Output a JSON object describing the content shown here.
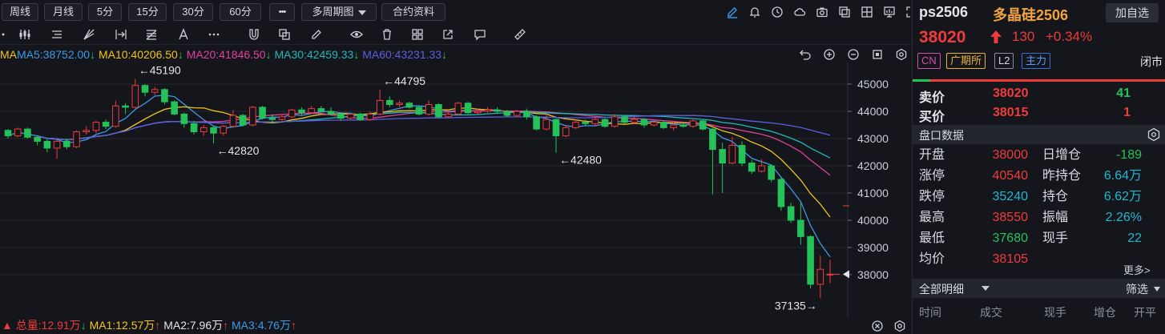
{
  "periods": {
    "buttons": [
      "周线",
      "月线",
      "5分",
      "15分",
      "30分",
      "60分"
    ],
    "more_label": "•••",
    "multi_label": "多周期图",
    "contract_label": "合约资料"
  },
  "ma_legend": {
    "title": "MA",
    "ma5": "MA5:38752.00",
    "ma10": "MA10:40206.50",
    "ma20": "MA20:41846.50",
    "ma30": "MA30:42459.33",
    "ma60": "MA60:43231.33",
    "colors": {
      "ma5": "#3a9be6",
      "ma10": "#f0c419",
      "ma20": "#e040a0",
      "ma30": "#20b8b8",
      "ma60": "#5a5ee0",
      "title": "#f0c419"
    }
  },
  "volume_legend": {
    "total": "总量:12.91万",
    "ma1": "MA1:12.57万",
    "ma2": "MA2:7.96万",
    "ma3": "MA3:4.76万",
    "colors": {
      "total": "#ee3b3b",
      "ma1": "#f0c419",
      "ma2": "#e2e4e9",
      "ma3": "#3a9be6"
    }
  },
  "chart_data": {
    "type": "candlestick",
    "y_ticks": [
      45000,
      44000,
      43000,
      42000,
      41000,
      40000,
      39000,
      38000
    ],
    "ylim": [
      37000,
      45600
    ],
    "annotations": [
      {
        "text": "←45190",
        "value": 45190
      },
      {
        "text": "←44795",
        "value": 44795
      },
      {
        "text": "←42820",
        "value": 42820
      },
      {
        "text": "←42480",
        "value": 42480
      },
      {
        "text": "37135→",
        "value": 37135
      }
    ],
    "last_price": 38020,
    "candles": [
      [
        43300,
        43100,
        43350,
        43000
      ],
      [
        43100,
        43350,
        43400,
        43050
      ],
      [
        43350,
        43050,
        43400,
        43000
      ],
      [
        43050,
        42900,
        43100,
        42750
      ],
      [
        42900,
        42650,
        43000,
        42500
      ],
      [
        42650,
        42900,
        42950,
        42250
      ],
      [
        42900,
        42700,
        43000,
        42600
      ],
      [
        42700,
        43250,
        43300,
        42650
      ],
      [
        43250,
        43300,
        43450,
        43150
      ],
      [
        43300,
        43600,
        43650,
        43200
      ],
      [
        43600,
        43450,
        43700,
        43350
      ],
      [
        43450,
        44200,
        44400,
        43400
      ],
      [
        44200,
        44150,
        44300,
        43900
      ],
      [
        44150,
        44950,
        45190,
        44100
      ],
      [
        44950,
        44700,
        45000,
        44550
      ],
      [
        44700,
        44800,
        44900,
        44600
      ],
      [
        44800,
        44350,
        44850,
        44250
      ],
      [
        44350,
        43900,
        44400,
        43850
      ],
      [
        43900,
        43550,
        43950,
        43400
      ],
      [
        43550,
        43250,
        43650,
        43150
      ],
      [
        43250,
        43400,
        43500,
        43100
      ],
      [
        43400,
        43200,
        43450,
        42820
      ],
      [
        43200,
        43450,
        43500,
        43100
      ],
      [
        43450,
        43850,
        44050,
        43400
      ],
      [
        43850,
        43500,
        43900,
        43450
      ],
      [
        43500,
        44150,
        44200,
        43450
      ],
      [
        44150,
        43750,
        44200,
        43700
      ],
      [
        43750,
        43700,
        43900,
        43600
      ],
      [
        43700,
        43800,
        43900,
        43650
      ],
      [
        43800,
        44050,
        44100,
        43750
      ],
      [
        44050,
        43950,
        44150,
        43850
      ],
      [
        43950,
        44100,
        44200,
        43900
      ],
      [
        44100,
        44000,
        44200,
        43950
      ],
      [
        44000,
        43900,
        44150,
        43850
      ],
      [
        43900,
        43750,
        43950,
        43650
      ],
      [
        43750,
        43900,
        43950,
        43700
      ],
      [
        43900,
        43700,
        43950,
        43650
      ],
      [
        43700,
        43900,
        44000,
        43650
      ],
      [
        43900,
        44400,
        44795,
        43850
      ],
      [
        44400,
        44250,
        44550,
        44150
      ],
      [
        44250,
        44300,
        44400,
        44150
      ],
      [
        44300,
        44150,
        44350,
        44100
      ],
      [
        44150,
        43900,
        44200,
        43850
      ],
      [
        43900,
        44250,
        44400,
        43850
      ],
      [
        44250,
        43800,
        44300,
        43750
      ],
      [
        43800,
        43900,
        44050,
        43750
      ],
      [
        43900,
        44300,
        44350,
        43850
      ],
      [
        44300,
        43950,
        44350,
        43900
      ],
      [
        43950,
        44000,
        44100,
        43900
      ],
      [
        44000,
        44050,
        44150,
        43950
      ],
      [
        44050,
        44000,
        44150,
        43900
      ],
      [
        44000,
        43850,
        44050,
        43800
      ],
      [
        43850,
        44000,
        44050,
        43800
      ],
      [
        44000,
        43800,
        44100,
        43700
      ],
      [
        43800,
        43350,
        43850,
        43300
      ],
      [
        43350,
        43700,
        43850,
        43300
      ],
      [
        43700,
        43100,
        43750,
        42480
      ],
      [
        43100,
        43400,
        43500,
        43050
      ],
      [
        43400,
        43600,
        43700,
        43350
      ],
      [
        43600,
        43550,
        43700,
        43450
      ],
      [
        43550,
        43700,
        43800,
        43450
      ],
      [
        43700,
        43450,
        43750,
        43400
      ],
      [
        43450,
        43800,
        43900,
        43400
      ],
      [
        43800,
        43600,
        43850,
        43550
      ],
      [
        43600,
        43700,
        43800,
        43550
      ],
      [
        43700,
        43500,
        43750,
        43400
      ],
      [
        43500,
        43600,
        43700,
        43450
      ],
      [
        43600,
        43400,
        43650,
        43350
      ],
      [
        43400,
        43500,
        43600,
        43300
      ],
      [
        43500,
        43450,
        43600,
        43400
      ],
      [
        43450,
        43650,
        43700,
        43400
      ],
      [
        43650,
        43350,
        43700,
        43300
      ],
      [
        43350,
        42600,
        43400,
        40950
      ],
      [
        42600,
        42100,
        42850,
        41000
      ],
      [
        42100,
        42750,
        43050,
        42050
      ],
      [
        42750,
        42100,
        42900,
        42000
      ],
      [
        42100,
        41800,
        42200,
        41700
      ],
      [
        41800,
        42000,
        42250,
        41750
      ],
      [
        42000,
        41500,
        42050,
        41400
      ],
      [
        41500,
        40500,
        41550,
        40350
      ],
      [
        40500,
        40000,
        40650,
        39900
      ],
      [
        40000,
        39400,
        40650,
        39100
      ],
      [
        39400,
        37650,
        39450,
        37500
      ],
      [
        37650,
        38200,
        38700,
        37135
      ],
      [
        38000,
        38020,
        38550,
        37680
      ]
    ]
  },
  "price_axis_labels": [
    "45000",
    "44000",
    "43000",
    "42000",
    "41000",
    "40000",
    "39000",
    "38000"
  ],
  "right_panel": {
    "symbol": "ps2506",
    "name": "多晶硅2506",
    "add_label": "加自选",
    "last": "38020",
    "change": "130",
    "change_pct": "+0.34%",
    "tags": {
      "cn": "CN",
      "exchange": "广期所",
      "level": "L2",
      "main": "主力"
    },
    "status": "闭市",
    "ask": {
      "label": "卖价",
      "price": "38020",
      "qty": "41"
    },
    "bid": {
      "label": "买价",
      "price": "38015",
      "qty": "1"
    },
    "section_title": "盘口数据",
    "rows": [
      {
        "k1": "开盘",
        "v1": "38000",
        "k2": "日增仓",
        "v2": "-189"
      },
      {
        "k1": "涨停",
        "v1": "40540",
        "k2": "昨持仓",
        "v2": "6.64万"
      },
      {
        "k1": "跌停",
        "v1": "35240",
        "k2": "持仓",
        "v2": "6.62万"
      },
      {
        "k1": "最高",
        "v1": "38550",
        "k2": "振幅",
        "v2": "2.26%"
      },
      {
        "k1": "最低",
        "v1": "37680",
        "k2": "现手",
        "v2": "22"
      },
      {
        "k1": "均价",
        "v1": "38105",
        "k2": "",
        "v2": ""
      }
    ],
    "more": "更多>",
    "detail_title": "全部明细",
    "filter": "筛选",
    "columns": [
      "时间",
      "成交",
      "现手",
      "增仓",
      "开平"
    ]
  }
}
